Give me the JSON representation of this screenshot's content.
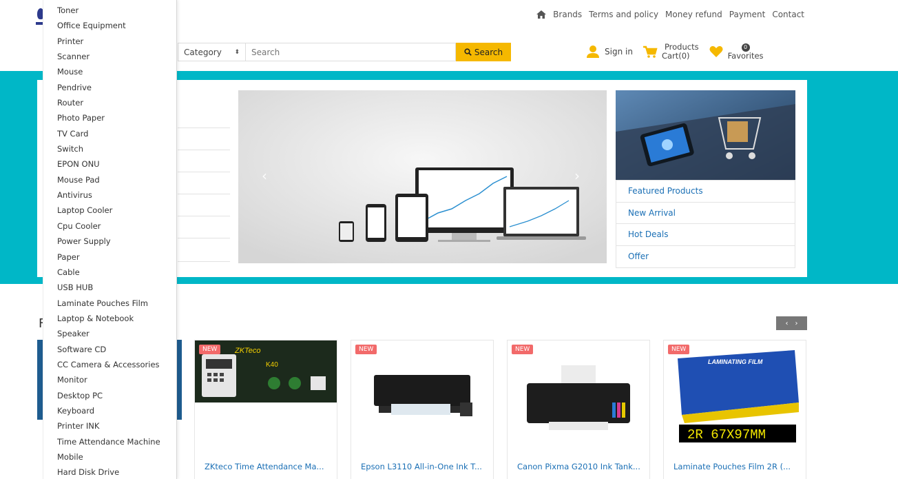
{
  "colors": {
    "teal_band": "#00b7c7",
    "search_button": "#f5b800",
    "link_blue": "#1a6fb5",
    "new_badge": "#f26a6a",
    "favorite_heart": "#f5b800"
  },
  "topnav": {
    "home_icon": "home-icon",
    "links": [
      "Brands",
      "Terms and policy",
      "Money refund",
      "Payment",
      "Contact"
    ]
  },
  "search": {
    "category_label": "Category",
    "placeholder": "Search",
    "button_label": "Search"
  },
  "account": {
    "sign_in": "Sign in",
    "cart_line1": "Products",
    "cart_line2": "Cart(0)",
    "favorites_count": "0",
    "favorites_label": "Favorites"
  },
  "side_links": [
    "Featured Products",
    "New Arrival",
    "Hot Deals",
    "Offer"
  ],
  "section": {
    "title_initial": "F"
  },
  "products": [
    {
      "badge": "NEW",
      "name": "ZKteco Time Attendance Ma..."
    },
    {
      "badge": "NEW",
      "name": "Epson L3110 All-in-One Ink T..."
    },
    {
      "badge": "NEW",
      "name": "Canon Pixma G2010 Ink Tank..."
    },
    {
      "badge": "NEW",
      "name": "Laminate Pouches Film 2R (..."
    }
  ],
  "product_image_text": {
    "zkteco_brand": "ZKTeco",
    "zkteco_model": "K40",
    "laminate_label": "LAMINATING FILM",
    "laminate_size": "2R 67X97MM"
  },
  "dropdown_items": [
    "Toner",
    "Office Equipment",
    "Printer",
    "Scanner",
    "Mouse",
    "Pendrive",
    "Router",
    "Photo Paper",
    "TV Card",
    "Switch",
    "EPON ONU",
    "Mouse Pad",
    "Antivirus",
    "Laptop Cooler",
    "Cpu Cooler",
    "Power Supply",
    "Paper",
    "Cable",
    "USB HUB",
    "Laminate Pouches Film",
    "Laptop & Notebook",
    "Speaker",
    "Software CD",
    "CC Camera & Accessories",
    "Monitor",
    "Desktop PC",
    "Keyboard",
    "Printer INK",
    "Time Attendance Machine",
    "Mobile",
    "Hard Disk Drive"
  ]
}
